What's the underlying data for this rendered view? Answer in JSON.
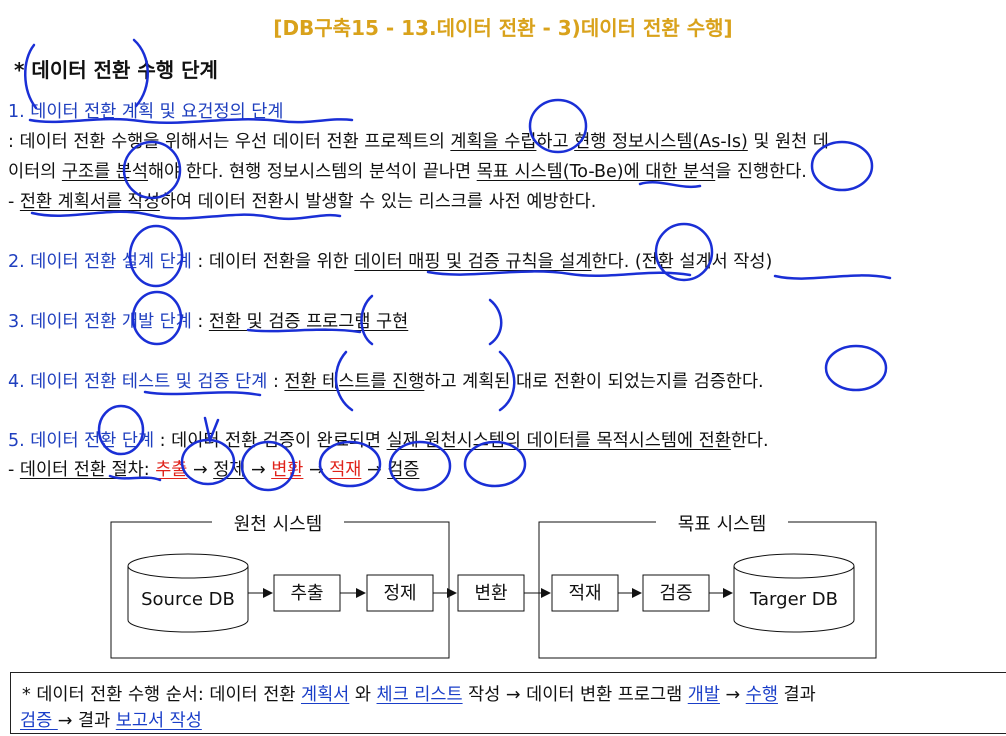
{
  "title": "[DB구축15 - 13.데이터 전환 - 3)데이터 전환 수행]",
  "section_title": "* 데이터 전환 수행 단계",
  "steps": [
    {
      "heading": "1. 데이터 전환 계획 및 요건정의 단계",
      "line1_a": ": 데이터 전환 수행을 위해서는 우선 데이터 전환 프로젝트의 ",
      "line1_u": "계획을 수립",
      "line1_b": "하고 ",
      "line1_u2": "현행 정보시스템(As-Is)",
      "line1_c": " 및 원천 데",
      "line2_a": "이터의 ",
      "line2_u": "구조를 분석",
      "line2_b": "해야 한다. 현행 정보시스템의 분석이 끝나면 ",
      "line2_u2": "목표 시스템(To-Be)에 대한 분석",
      "line2_c": "을 진행한다.",
      "line3_a": "- ",
      "line3_u": "전환 계획서를 작성",
      "line3_b": "하여 데이터 전환시 발생할 수 있는 리스크를 사전 예방한다."
    },
    {
      "heading": "2. 데이터 전환 설계 단계",
      "text_a": " : 데이터 전환을 위한 ",
      "text_u": "데이터 매핑 및 검증 규칙을 설계",
      "text_b": "한다. (전환 설계서 작성)"
    },
    {
      "heading": "3. 데이터 전환 개발 단계",
      "text_a": " : ",
      "text_u": "전환 및 검증 프로그램 구현"
    },
    {
      "heading": "4. 데이터 전환 테스트 및 검증 단계",
      "text_a": " : ",
      "text_u": "전환 테스트를 진행",
      "text_b": "하고 계획된 대로 전환이 되었는지를 검증한다."
    },
    {
      "heading": "5. 데이터 전환 단계",
      "text_a": " : 데이터 전환 검증이 완료되면 ",
      "text_u": "실제 원천시스템의 데이터를 목적시스템에 전환",
      "text_b": "한다.",
      "proc_prefix": "- ",
      "proc_label": "데이터 전환 절차: ",
      "proc_1": "추출",
      "proc_arrow": " → ",
      "proc_2": "정제",
      "proc_3": "변환",
      "proc_4": "적재",
      "proc_5": "검증"
    }
  ],
  "diagram": {
    "source_group": "원천 시스템",
    "target_group": "목표 시스템",
    "source_db": "Source DB",
    "target_db": "Targer DB",
    "boxes": [
      "추출",
      "정제",
      "변환",
      "적재",
      "검증"
    ]
  },
  "footer": {
    "a": "* 데이터 전환 수행 순서: 데이터 전환 ",
    "l1": "계획서",
    "b": " 와 ",
    "l2": "체크 리스트",
    "c": " 작성 → 데이터 변환 프로그램 ",
    "l3": "개발",
    "d": " → ",
    "l4": "수행",
    "e": " 결과",
    "l5": "검증 ",
    "f": "→ 결과 ",
    "l6": "보고서 작성"
  },
  "colors": {
    "title": "#d9a21b",
    "heading": "#1f3fbf",
    "highlight": "#e0221a",
    "annotation": "#1a2fd6"
  }
}
